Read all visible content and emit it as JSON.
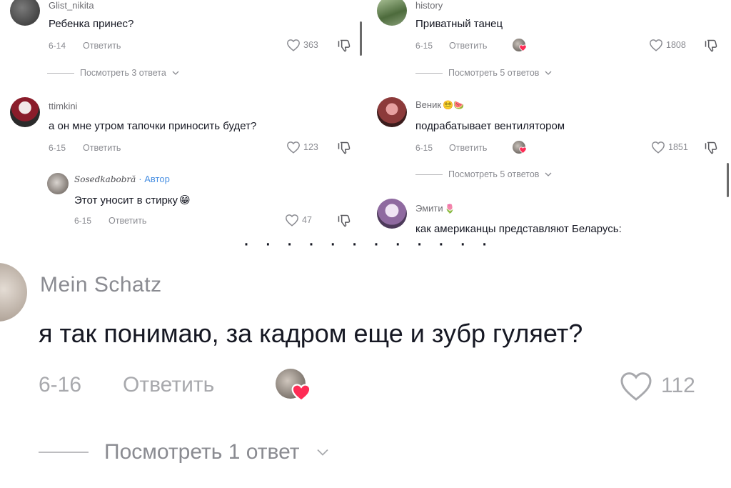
{
  "ui": {
    "reply_label": "Ответить",
    "author_tag": "· Автор"
  },
  "left": {
    "comments": [
      {
        "username": "Glist_nikita",
        "text": "Ребенка принес?",
        "date": "6-14",
        "likes": "363",
        "view_replies": "Посмотреть 3 ответа"
      },
      {
        "username": "ttimkini",
        "text": "а он мне утром тапочки приносить будет?",
        "date": "6-15",
        "likes": "123"
      }
    ],
    "reply": {
      "username": "Sosedkabobră",
      "text": "Этот уносит в стирку",
      "emoji": "😁",
      "date": "6-15",
      "likes": "47"
    }
  },
  "right": {
    "comments": [
      {
        "username": "history",
        "text": "Приватный танец",
        "date": "6-15",
        "likes": "1808",
        "view_replies": "Посмотреть 5 ответов"
      },
      {
        "username": "Веник",
        "username_emoji": "😵‍💫🍉",
        "text": "подрабатывает вентилятором",
        "date": "6-15",
        "likes": "1851",
        "view_replies": "Посмотреть 5 ответов"
      },
      {
        "username": "Эмити",
        "username_emoji": "🌷",
        "text": "как американцы представляют Беларусь:"
      }
    ]
  },
  "big_comment": {
    "username": "Mein Schatz",
    "text": "я так понимаю, за кадром еще и зубр гуляет?",
    "date": "6-16",
    "likes": "112",
    "view_replies": "Посмотреть 1 ответ"
  },
  "colors": {
    "text": "#161823",
    "muted": "#8a8b91",
    "author_tag": "#4a90e2",
    "heart_badge": "#fe2c55"
  }
}
